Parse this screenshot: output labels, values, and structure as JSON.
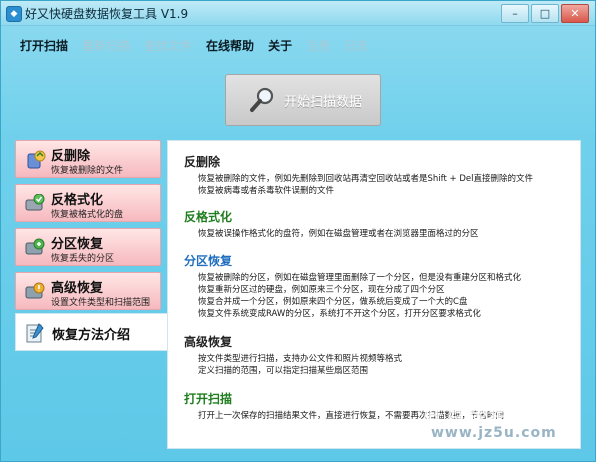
{
  "window": {
    "title": "好又快硬盘数据恢复工具 V1.9",
    "controls": {
      "minimize": "–",
      "maximize": "□",
      "close": "✕"
    }
  },
  "menu": [
    {
      "label": "打开扫描",
      "enabled": true
    },
    {
      "label": "重新扫描",
      "enabled": false
    },
    {
      "label": "查找文件",
      "enabled": false
    },
    {
      "label": "在线帮助",
      "enabled": true
    },
    {
      "label": "关于",
      "enabled": true
    },
    {
      "label": "注册",
      "enabled": false
    },
    {
      "label": "日志",
      "enabled": false
    }
  ],
  "start_button": {
    "label": "开始扫描数据",
    "icon": "magnifier-icon"
  },
  "sidebar": {
    "items": [
      {
        "title": "反删除",
        "subtitle": "恢复被删除的文件",
        "icon": "recycle-icon"
      },
      {
        "title": "反格式化",
        "subtitle": "恢复被格式化的盘",
        "icon": "disk-icon"
      },
      {
        "title": "分区恢复",
        "subtitle": "恢复丢失的分区",
        "icon": "partition-icon"
      },
      {
        "title": "高级恢复",
        "subtitle": "设置文件类型和扫描范围",
        "icon": "advanced-icon"
      }
    ],
    "active": {
      "title": "恢复方法介绍",
      "icon": "info-icon"
    }
  },
  "content": {
    "sections": [
      {
        "title": "反删除",
        "color": "#222222",
        "lines": [
          "恢复被删除的文件，例如先删除到回收站再清空回收站或者是Shift + Del直接删除的文件",
          "恢复被病毒或者杀毒软件误删的文件"
        ]
      },
      {
        "title": "反格式化",
        "color": "#1f7d1f",
        "lines": [
          "恢复被误操作格式化的盘符，例如在磁盘管理或者在浏览器里面格过的分区"
        ]
      },
      {
        "title": "分区恢复",
        "color": "#1f6fbf",
        "lines": [
          "恢复被删除的分区，例如在磁盘管理里面删除了一个分区，但是没有重建分区和格式化",
          "恢复重新分区过的硬盘，例如原来三个分区，现在分成了四个分区",
          "恢复合并成一个分区，例如原来四个分区，做系统后变成了一个大的C盘",
          "恢复文件系统变成RAW的分区，系统打不开这个分区，打开分区要求格式化"
        ]
      },
      {
        "title": "高级恢复",
        "color": "#222222",
        "lines": [
          "按文件类型进行扫描，支持办公文件和照片视频等格式",
          "定义扫描的范围，可以指定扫描某些扇区范围"
        ]
      },
      {
        "title": "打开扫描",
        "color": "#1f7d1f",
        "lines": [
          "打开上一次保存的扫描结果文件，直接进行恢复，不需要再次扫描数据，节省时间"
        ]
      }
    ]
  },
  "watermark": {
    "line1": "好且绿色下载",
    "line2": "www.jz5u.com"
  }
}
